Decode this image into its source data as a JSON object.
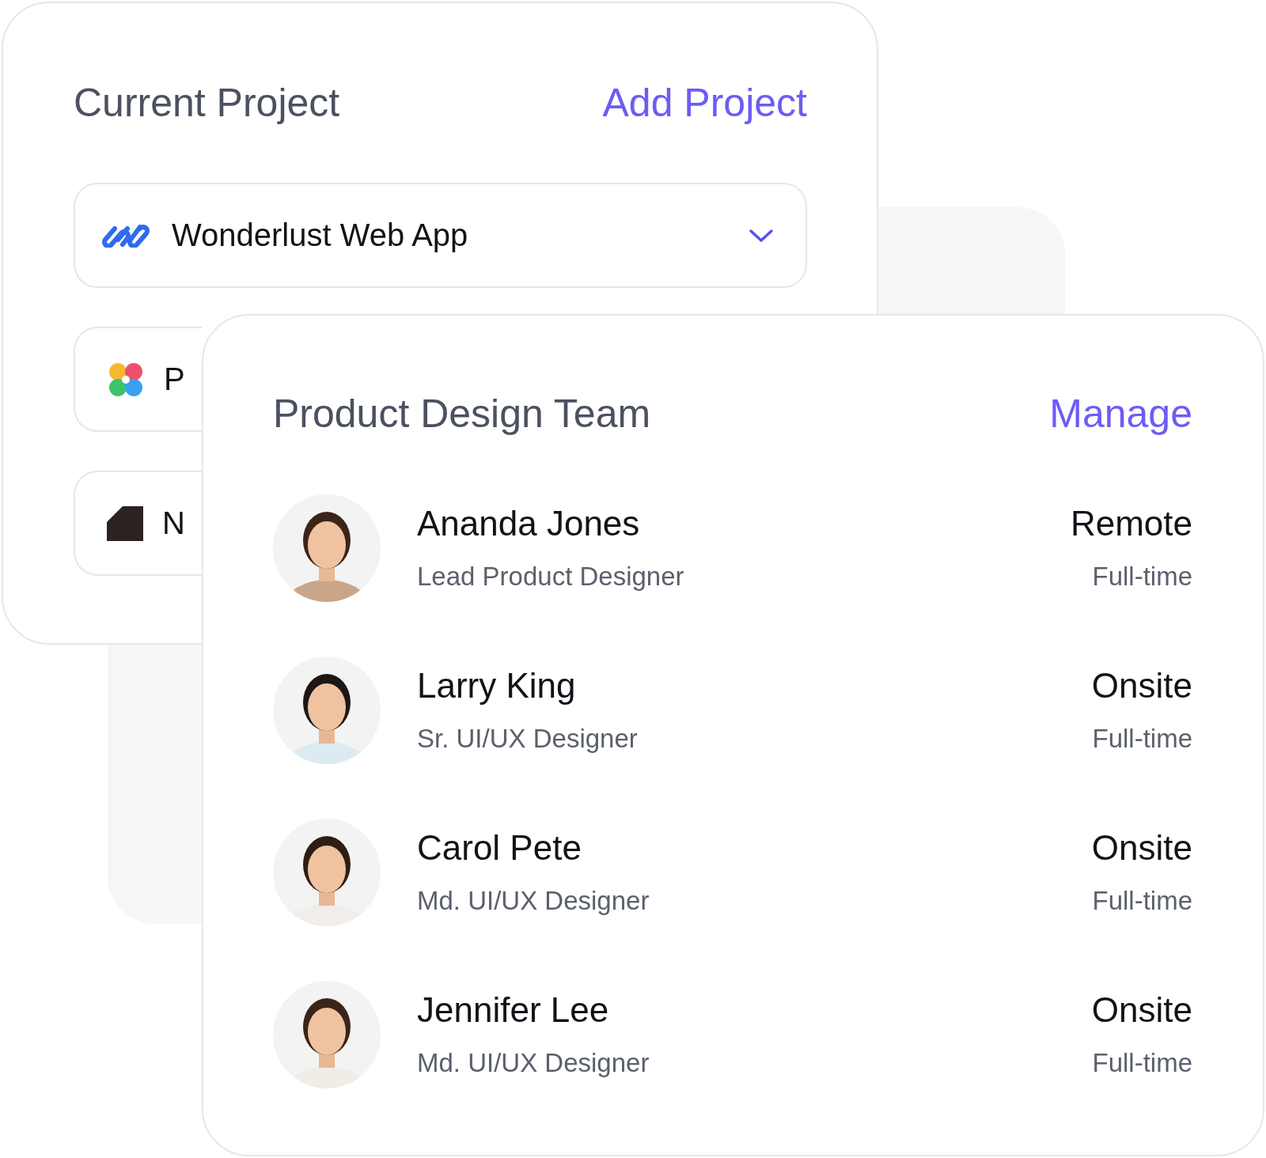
{
  "current_project": {
    "title": "Current Project",
    "add_link": "Add Project",
    "projects": [
      {
        "name": "Wonderlust Web App",
        "kind": "dropdown"
      },
      {
        "name": "P",
        "kind": "item"
      },
      {
        "name": "N",
        "kind": "item"
      }
    ]
  },
  "team": {
    "title": "Product Design Team",
    "manage_link": "Manage",
    "members": [
      {
        "name": "Ananda Jones",
        "role": "Lead Product Designer",
        "location": "Remote",
        "type": "Full-time"
      },
      {
        "name": "Larry King",
        "role": "Sr. UI/UX Designer",
        "location": "Onsite",
        "type": "Full-time"
      },
      {
        "name": "Carol Pete",
        "role": "Md. UI/UX Designer",
        "location": "Onsite",
        "type": "Full-time"
      },
      {
        "name": "Jennifer Lee",
        "role": "Md. UI/UX Designer",
        "location": "Onsite",
        "type": "Full-time"
      }
    ]
  }
}
